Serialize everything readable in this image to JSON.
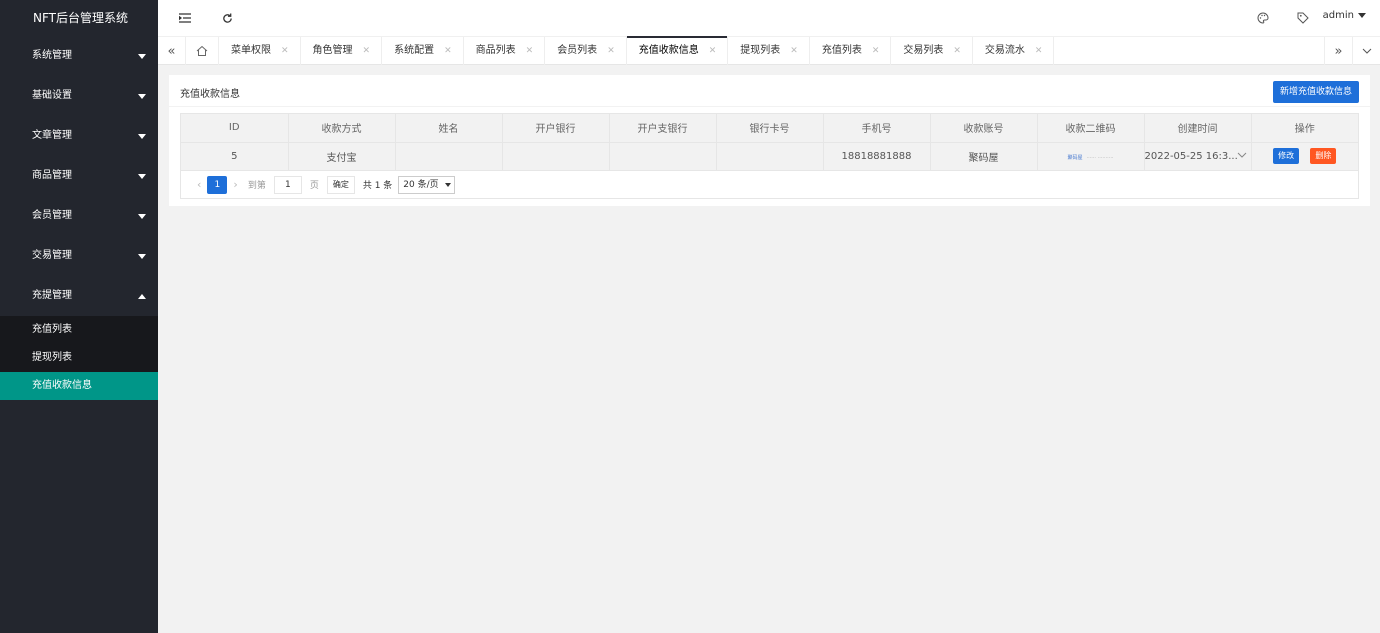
{
  "app": {
    "title": "NFT后台管理系统"
  },
  "sidebar": {
    "items": [
      {
        "label": "系统管理"
      },
      {
        "label": "基础设置"
      },
      {
        "label": "文章管理"
      },
      {
        "label": "商品管理"
      },
      {
        "label": "会员管理"
      },
      {
        "label": "交易管理"
      },
      {
        "label": "充提管理"
      }
    ],
    "sub_items": [
      {
        "label": "充值列表"
      },
      {
        "label": "提现列表"
      },
      {
        "label": "充值收款信息"
      }
    ]
  },
  "header": {
    "user": "admin",
    "icons": [
      "menu-fold-icon",
      "refresh-icon",
      "theme-icon",
      "tag-icon"
    ]
  },
  "tabs": [
    {
      "label": "菜单权限"
    },
    {
      "label": "角色管理"
    },
    {
      "label": "系统配置"
    },
    {
      "label": "商品列表"
    },
    {
      "label": "会员列表"
    },
    {
      "label": "充值收款信息"
    },
    {
      "label": "提现列表"
    },
    {
      "label": "充值列表"
    },
    {
      "label": "交易列表"
    },
    {
      "label": "交易流水"
    }
  ],
  "main": {
    "title": "充值收款信息",
    "add_button": "新增充值收款信息",
    "columns": [
      "ID",
      "收款方式",
      "姓名",
      "开户银行",
      "开户支银行",
      "银行卡号",
      "手机号",
      "收款账号",
      "收款二维码",
      "创建时间",
      "操作"
    ],
    "rows": [
      {
        "id": "5",
        "method": "支付宝",
        "name": "",
        "bank": "",
        "branch": "",
        "card": "",
        "phone": "18818881888",
        "account": "聚码屋",
        "qr_text": "聚码屋",
        "qr_sub": "······ ··········",
        "created": "2022-05-25 16:3...",
        "edit": "修改",
        "delete": "删除"
      }
    ],
    "pager": {
      "current": "1",
      "goto_label": "到第",
      "goto_value": "1",
      "page_label": "页",
      "confirm": "确定",
      "total": "共 1 条",
      "size": "20 条/页"
    }
  },
  "colors": {
    "sidebar": "#23262e",
    "active": "#009688",
    "primary": "#1e6fd9",
    "danger": "#ff5722"
  }
}
